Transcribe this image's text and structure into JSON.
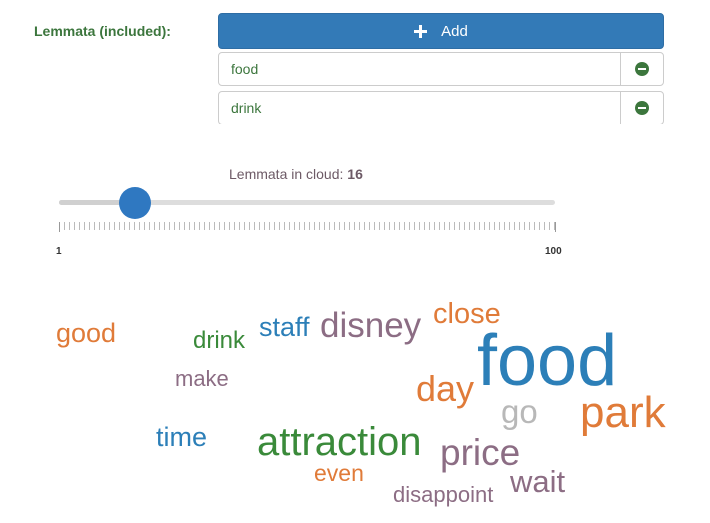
{
  "lemmata": {
    "label": "Lemmata (included):",
    "add_label": "Add",
    "items": [
      {
        "text": "food"
      },
      {
        "text": "drink"
      }
    ]
  },
  "slider": {
    "label_prefix": "Lemmata in cloud:",
    "value": "16",
    "min_label": "1",
    "max_label": "100"
  },
  "cloud": {
    "words": [
      {
        "text": "good",
        "color": "#e07b39"
      },
      {
        "text": "drink",
        "color": "#3a8a3a"
      },
      {
        "text": "staff",
        "color": "#2c7fb8"
      },
      {
        "text": "disney",
        "color": "#8c6d84"
      },
      {
        "text": "close",
        "color": "#e07b39"
      },
      {
        "text": "make",
        "color": "#8c6d84"
      },
      {
        "text": "food",
        "color": "#2c7fb8"
      },
      {
        "text": "day",
        "color": "#e07b39"
      },
      {
        "text": "go",
        "color": "#b8b8b8"
      },
      {
        "text": "park",
        "color": "#e07b39"
      },
      {
        "text": "time",
        "color": "#2c7fb8"
      },
      {
        "text": "attraction",
        "color": "#3a8a3a"
      },
      {
        "text": "price",
        "color": "#8c6d84"
      },
      {
        "text": "even",
        "color": "#e07b39"
      },
      {
        "text": "wait",
        "color": "#8c6d84"
      },
      {
        "text": "disappoint",
        "color": "#8c6d84"
      }
    ]
  }
}
